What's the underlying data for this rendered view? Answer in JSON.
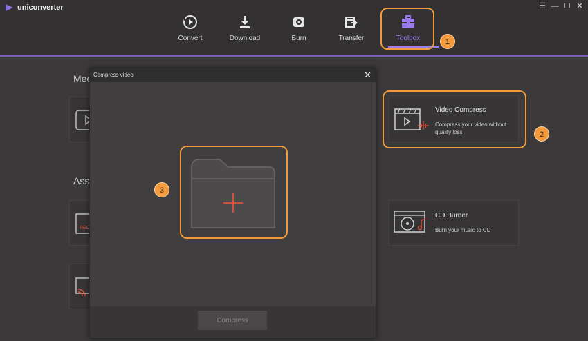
{
  "app": {
    "name": "uniconverter"
  },
  "window_controls": {
    "menu": "☰",
    "minimize": "—",
    "maximize": "☐",
    "close": "✕"
  },
  "nav": {
    "items": [
      {
        "label": "Convert",
        "icon": "convert-icon"
      },
      {
        "label": "Download",
        "icon": "download-icon"
      },
      {
        "label": "Burn",
        "icon": "burn-icon"
      },
      {
        "label": "Transfer",
        "icon": "transfer-icon"
      },
      {
        "label": "Toolbox",
        "icon": "toolbox-icon"
      }
    ],
    "active": "Toolbox"
  },
  "badges": {
    "one": "1",
    "two": "2",
    "three": "3"
  },
  "sections": {
    "media_partial": "Med",
    "assistant_partial": "Ass"
  },
  "cards": {
    "video_compress": {
      "title": "Video Compress",
      "desc": "Compress your video without quality loss"
    },
    "cd_burner": {
      "title": "CD Burner",
      "desc": "Burn your music to CD"
    }
  },
  "partial_texts": {
    "rec": "REC"
  },
  "dialog": {
    "title": "Compress video",
    "close": "✕",
    "compress_button": "Compress"
  },
  "colors": {
    "accent": "#9b7cf0",
    "highlight": "#f39a3c",
    "add_plus": "#e0533f"
  }
}
